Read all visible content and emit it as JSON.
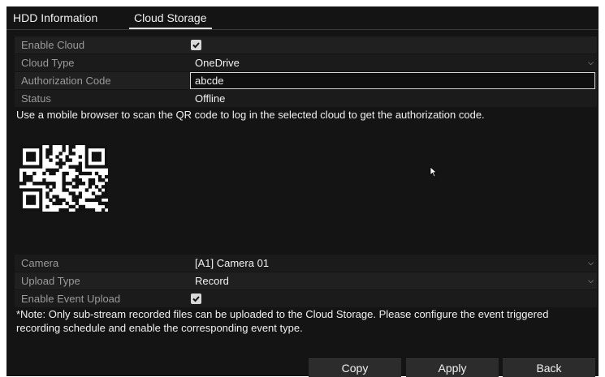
{
  "tabs": [
    {
      "label": "HDD Information",
      "active": false
    },
    {
      "label": "Cloud Storage",
      "active": true
    }
  ],
  "settings": {
    "enable_cloud": {
      "label": "Enable Cloud",
      "checked": true
    },
    "cloud_type": {
      "label": "Cloud Type",
      "value": "OneDrive"
    },
    "auth_code": {
      "label": "Authorization Code",
      "value": "abcde"
    },
    "status": {
      "label": "Status",
      "value": "Offline"
    }
  },
  "instructions": "Use a mobile browser to scan the QR code to log in the selected cloud to get the authorization code.",
  "upload": {
    "camera": {
      "label": "Camera",
      "value": "[A1] Camera 01"
    },
    "upload_type": {
      "label": "Upload Type",
      "value": "Record"
    },
    "enable_event_upload": {
      "label": "Enable Event Upload",
      "checked": true
    }
  },
  "note": "*Note: Only sub-stream recorded files can be uploaded to the Cloud Storage. Please configure the event triggered recording schedule and enable the corresponding event type.",
  "buttons": {
    "copy": "Copy",
    "apply": "Apply",
    "back": "Back"
  },
  "icons": {
    "dropdown": "chevron-down-icon",
    "checkbox": "check-icon",
    "cursor": "mouse-pointer-icon"
  }
}
